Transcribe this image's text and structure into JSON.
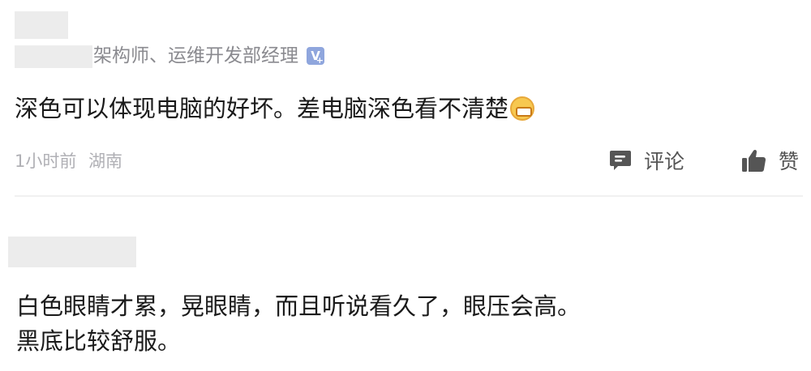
{
  "comment_1": {
    "author_title": "架构师、运维开发部经理",
    "badge_text": "V",
    "text": "深色可以体现电脑的好坏。差电脑深色看不清楚",
    "emoji": "grimace-emoji",
    "time": "1小时前",
    "location": "湖南",
    "comment_label": "评论",
    "like_label": "赞"
  },
  "comment_2": {
    "lines": [
      "白色眼睛才累，晃眼睛，而且听说看久了，眼压会高。",
      "黑底比较舒服。"
    ]
  },
  "colors": {
    "meta_gray": "#b0b0b5",
    "badge_blue": "#8fa6dd",
    "icon_dark": "#555555"
  }
}
